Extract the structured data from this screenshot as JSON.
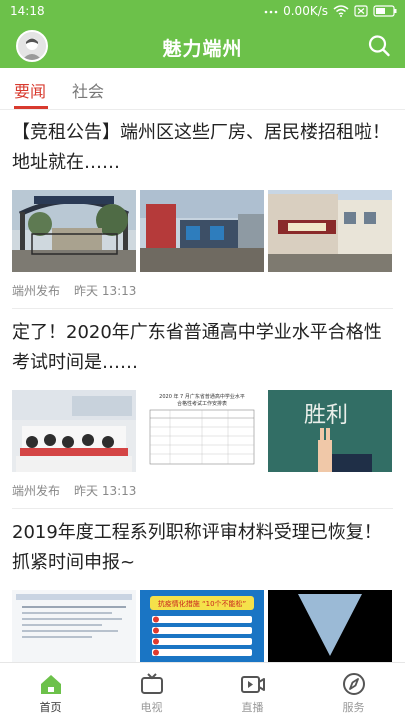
{
  "status_bar": {
    "time": "14:18",
    "network_speed": "0.00K/s",
    "battery_icon": "battery-icon"
  },
  "header": {
    "title": "魅力端州",
    "avatar_icon": "avatar-icon",
    "search_icon": "search-icon",
    "brand_color": "#6cc14a"
  },
  "tabs": [
    {
      "label": "要闻",
      "active": true
    },
    {
      "label": "社会",
      "active": false
    }
  ],
  "accent_color": "#d83a2e",
  "articles": [
    {
      "title": "【竞租公告】端州区这些厂房、居民楼招租啦！地址就在……",
      "source": "端州发布",
      "time": "昨天 13:13"
    },
    {
      "title": "定了！2020年广东省普通高中学业水平合格性考试时间是……",
      "source": "端州发布",
      "time": "昨天 13:13"
    },
    {
      "title": "2019年度工程系列职称评审材料受理已恢复！抓紧时间申报~"
    }
  ],
  "image_text": {
    "exam_doc_title": "2020 年 7 月广东省普通高中学业水平",
    "exam_doc_subtitle": "合格性考试工作安排表",
    "blackboard_text": "胜利",
    "poster_title": "抗疫情化措施 “10个不能松”"
  },
  "bottom_nav": [
    {
      "label": "首页",
      "icon": "home-icon",
      "active": true
    },
    {
      "label": "电视",
      "icon": "tv-icon",
      "active": false
    },
    {
      "label": "直播",
      "icon": "live-video-icon",
      "active": false
    },
    {
      "label": "服务",
      "icon": "compass-icon",
      "active": false
    }
  ]
}
